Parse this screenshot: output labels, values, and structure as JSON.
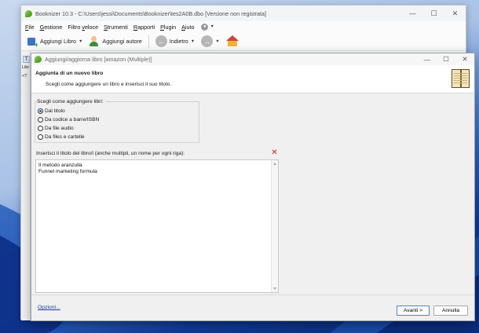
{
  "colors": {
    "accent": "#1a5fb4",
    "link": "#1d3f9e",
    "clear_icon": "#d42020",
    "desktop_dark": "#0b2a6e"
  },
  "main_window": {
    "title": "Booknizer 10.3 - C:\\Users\\jessi\\Documents\\Booknizer\\tes2A0B.dbo [Versione non registrata]",
    "controls": {
      "minimize": "—",
      "maximize": "☐",
      "close": "✕"
    },
    "menu": [
      {
        "mnemonic": "F",
        "rest": "ile"
      },
      {
        "mnemonic": "G",
        "rest": "estione"
      },
      {
        "pre": "Filtro ",
        "mnemonic": "v",
        "rest": "eloce"
      },
      {
        "mnemonic": "S",
        "rest": "trumenti"
      },
      {
        "mnemonic": "R",
        "rest": "apporti"
      },
      {
        "mnemonic": "P",
        "rest": "lugin"
      },
      {
        "mnemonic": "A",
        "rest": "iuto"
      }
    ],
    "toolbar": {
      "add_book": "Aggiungi Libro",
      "add_author": "Aggiungi autore",
      "back": "Indietro"
    },
    "side": {
      "tab": "T",
      "label_a": "Libr",
      "label_b": "<T"
    }
  },
  "dialog": {
    "title": "Aggiungi/aggiorna libro [amazon (Multiple)]",
    "header_title": "Aggiunta di un nuovo libro",
    "header_subtitle": "Scegli come aggiungere un libro e inserisci il suo titolo.",
    "method_group_label": "Scegli come aggiungere libri:",
    "methods": [
      {
        "label": "Dal titolo",
        "checked": true
      },
      {
        "label": "Da codice a barre/ISBN",
        "checked": false
      },
      {
        "label": "Da file audio",
        "checked": false
      },
      {
        "label": "Da files e cartelle",
        "checked": false
      }
    ],
    "titles_label": "Inserisci il titolo del libro/i (anche multipli, un nome per ogni riga):",
    "titles": [
      "Il metodo aranzulla",
      "Funnel marketing formula"
    ],
    "options_link": "Opzioni...",
    "next_button": "Avanti >",
    "cancel_button": "Annulla"
  }
}
